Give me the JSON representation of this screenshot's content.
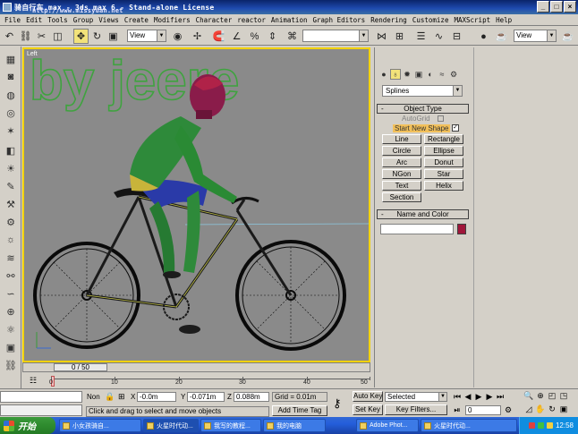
{
  "window": {
    "title": "骑自行车.max - 3ds max 6 - Stand-alone License",
    "watermark": "http://www.missyuan.net"
  },
  "menu": [
    "File",
    "Edit",
    "Tools",
    "Group",
    "Views",
    "Create",
    "Modifiers",
    "Character",
    "reactor",
    "Animation",
    "Graph Editors",
    "Rendering",
    "Customize",
    "MAXScript",
    "Help"
  ],
  "toolbar": {
    "reference_coord": "View",
    "named_selection": "",
    "view_dropdown": "View"
  },
  "viewport": {
    "label": "Left",
    "overlay_text": "by jeere"
  },
  "command_panel": {
    "category_dropdown": "Splines",
    "object_type_title": "Object Type",
    "autogrid_label": "AutoGrid",
    "start_new_shape_label": "Start New Shape",
    "shape_buttons": [
      "Line",
      "Rectangle",
      "Circle",
      "Ellipse",
      "Arc",
      "Donut",
      "NGon",
      "Star",
      "Text",
      "Helix",
      "Section"
    ],
    "name_color_title": "Name and Color",
    "name_value": "",
    "object_color": "#a0163a"
  },
  "timeline": {
    "slider_label": "0 / 50",
    "ticks": [
      "0",
      "10",
      "20",
      "30",
      "40",
      "50"
    ]
  },
  "status": {
    "selection_lock": "Non",
    "x_label": "X",
    "x_value": "-0.0m",
    "y_label": "Y",
    "y_value": "-0.071m",
    "z_label": "Z",
    "z_value": "0.088m",
    "grid": "Grid = 0.01m",
    "prompt": "Click and drag to select and move objects",
    "add_time_tag": "Add Time Tag",
    "auto_key": "Auto Key",
    "set_key": "Set Key",
    "key_mode_dropdown": "Selected",
    "key_filters": "Key Filters...",
    "current_frame": "0"
  },
  "taskbar": {
    "start_label": "开始",
    "tasks": [
      "小女孩骑自...",
      "火星时代动...",
      "我写的教程...",
      "我的电脑",
      "Adobe Phot...",
      "火星时代动..."
    ],
    "clock": "12:58"
  }
}
